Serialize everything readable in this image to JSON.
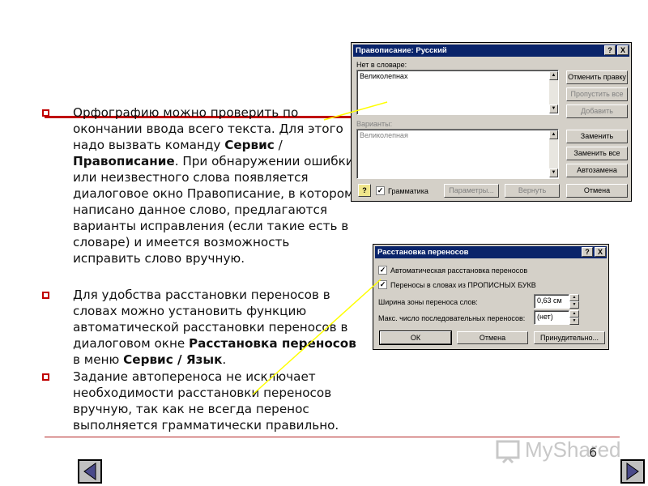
{
  "bullets": [
    {
      "parts": [
        {
          "t": "Орфографию можно проверить по окончании ввода всего текста. Для этого надо вызвать команду ",
          "b": false
        },
        {
          "t": "Сервис",
          "b": true
        },
        {
          "t": " / ",
          "b": false
        },
        {
          "t": "Правописание",
          "b": true
        },
        {
          "t": ". При обнаружении ошибки или неизвестного слова появляется диалоговое окно Правописание, в котором написано данное слово, предлагаются варианты исправления (если такие есть в словаре) и имеется возможность исправить слово вручную.",
          "b": false
        }
      ]
    },
    {
      "parts": [
        {
          "t": "Для удобства расстановки переносов в словах можно установить функцию автоматической расстановки переносов в диалоговом окне ",
          "b": false
        },
        {
          "t": "Расстановка переносов",
          "b": true
        },
        {
          "t": " в меню ",
          "b": false
        },
        {
          "t": "Сервис / Язык",
          "b": true
        },
        {
          "t": ".",
          "b": false
        }
      ]
    },
    {
      "parts": [
        {
          "t": "Задание автопереноса не исключает необходимости расстановки переносов вручную, так как не всегда перенос выполняется грамматически правильно.",
          "b": false
        }
      ]
    }
  ],
  "spelling_dialog": {
    "title": "Правописание: Русский",
    "not_in_dict_label": "Нет в словаре:",
    "word": "Великолепнах",
    "variants_label": "Варианты:",
    "variant": "Великолепная",
    "grammar_label": "Грамматика",
    "grammar_checked": true,
    "buttons": {
      "undo_edit": "Отменить правку",
      "skip_all": "Пропустить все",
      "add": "Добавить",
      "replace": "Заменить",
      "replace_all": "Заменить все",
      "autocorrect": "Автозамена",
      "options": "Параметры...",
      "undo": "Вернуть",
      "cancel": "Отмена"
    },
    "help_btn": "?",
    "close_btn": "X"
  },
  "hyphen_dialog": {
    "title": "Расстановка переносов",
    "auto_label": "Автоматическая расстановка переносов",
    "auto_checked": true,
    "caps_label": "Переносы в словах из ПРОПИСНЫХ БУКВ",
    "caps_checked": true,
    "zone_label": "Ширина зоны переноса слов:",
    "zone_value": "0,63 см",
    "max_label": "Макс. число последовательных переносов:",
    "max_value": "(нет)",
    "ok": "ОК",
    "cancel": "Отмена",
    "forced": "Принудительно...",
    "help_btn": "?",
    "close_btn": "X"
  },
  "footer": {
    "logo_text": "MyShared",
    "page_number": "6"
  },
  "colors": {
    "accent_red": "#c00000",
    "line_red": "#b22222",
    "pointer_yellow": "#ffff00",
    "titlebar": "#0a246a"
  }
}
